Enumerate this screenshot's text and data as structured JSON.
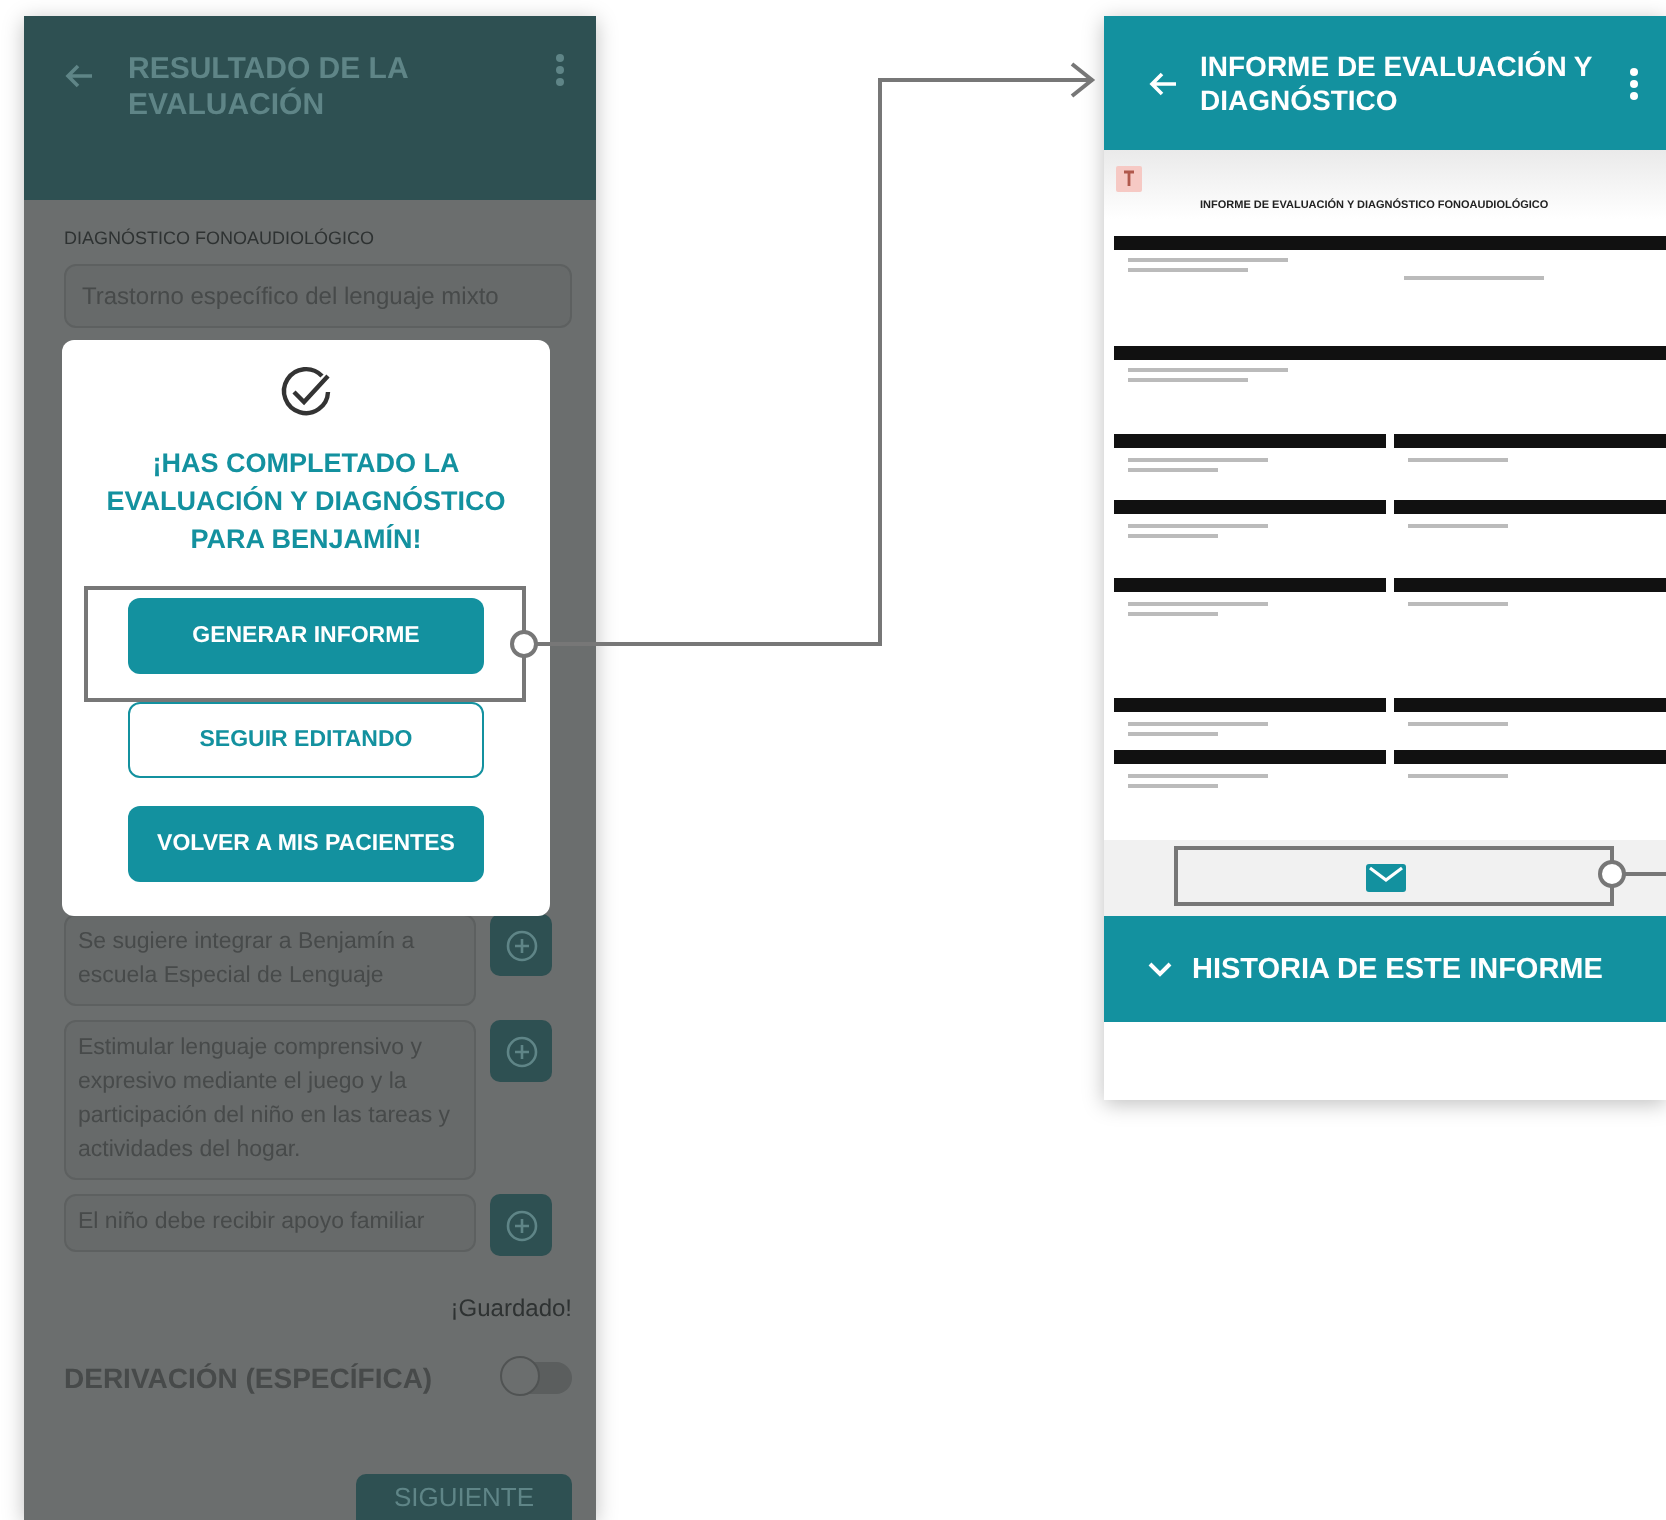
{
  "evaluation_screen": {
    "title": "RESULTADO DE LA EVALUACIÓN",
    "diagnosis": {
      "label": "DIAGNÓSTICO FONOAUDIOLÓGICO",
      "value": "Trastorno específico del lenguaje mixto"
    },
    "recommendations": [
      {
        "value": "Se sugiere integrar a Benjamín a escuela Especial de Lenguaje"
      },
      {
        "value": "Estimular lenguaje comprensivo y expresivo mediante el juego y la participación del niño en las tareas y actividades del hogar."
      },
      {
        "value": "El niño debe recibir apoyo familiar"
      }
    ],
    "save_status": "¡Guardado!",
    "referral": {
      "label": "DERIVACIÓN (ESPECÍFICA)",
      "on": false
    },
    "next_button": "SIGUIENTE"
  },
  "completion_dialog": {
    "message": "¡HAS COMPLETADO LA EVALUACIÓN Y DIAGNÓSTICO PARA BENJAMÍN!",
    "buttons": [
      {
        "label": "GENERAR INFORME",
        "kind": "filled"
      },
      {
        "label": "SEGUIR EDITANDO",
        "kind": "outlined"
      },
      {
        "label": "VOLVER A MIS PACIENTES",
        "kind": "filled"
      }
    ]
  },
  "report_screen": {
    "title": "INFORME DE EVALUACIÓN Y DIAGNÓSTICO",
    "document_title": "INFORME DE EVALUACIÓN Y DIAGNÓSTICO FONOAUDIOLÓGICO",
    "history_label": "HISTORIA DE ESTE INFORME"
  }
}
